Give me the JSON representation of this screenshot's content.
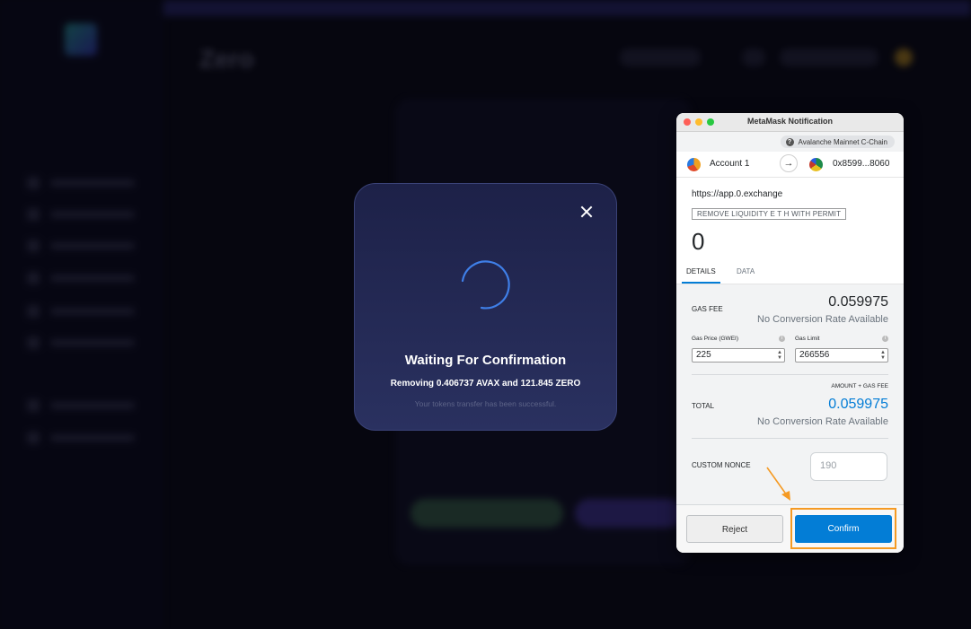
{
  "background_app": {
    "brand": "Zero"
  },
  "waiting_modal": {
    "title": "Waiting For Confirmation",
    "subtitle": "Removing 0.406737 AVAX and 121.845 ZERO",
    "note": "Your tokens transfer has been successful."
  },
  "metamask": {
    "window_title": "MetaMask Notification",
    "network": "Avalanche Mainnet C-Chain",
    "from_account": "Account 1",
    "to_address": "0x8599...8060",
    "origin": "https://app.0.exchange",
    "method": "REMOVE LIQUIDITY E T H WITH PERMIT",
    "amount": "0",
    "tabs": [
      {
        "label": "DETAILS",
        "active": true
      },
      {
        "label": "DATA",
        "active": false
      }
    ],
    "gas_fee": {
      "label": "GAS FEE",
      "value": "0.059975",
      "conversion": "No Conversion Rate Available"
    },
    "gas_price": {
      "label": "Gas Price (GWEI)",
      "value": "225"
    },
    "gas_limit": {
      "label": "Gas Limit",
      "value": "266556"
    },
    "total": {
      "caption": "AMOUNT + GAS FEE",
      "label": "TOTAL",
      "value": "0.059975",
      "conversion": "No Conversion Rate Available"
    },
    "nonce": {
      "label": "CUSTOM NONCE",
      "placeholder": "190"
    },
    "reject_label": "Reject",
    "confirm_label": "Confirm"
  },
  "colors": {
    "metamask_blue": "#037dd6",
    "annotation_orange": "#f59a23",
    "modal_bg": "#1d2148"
  }
}
